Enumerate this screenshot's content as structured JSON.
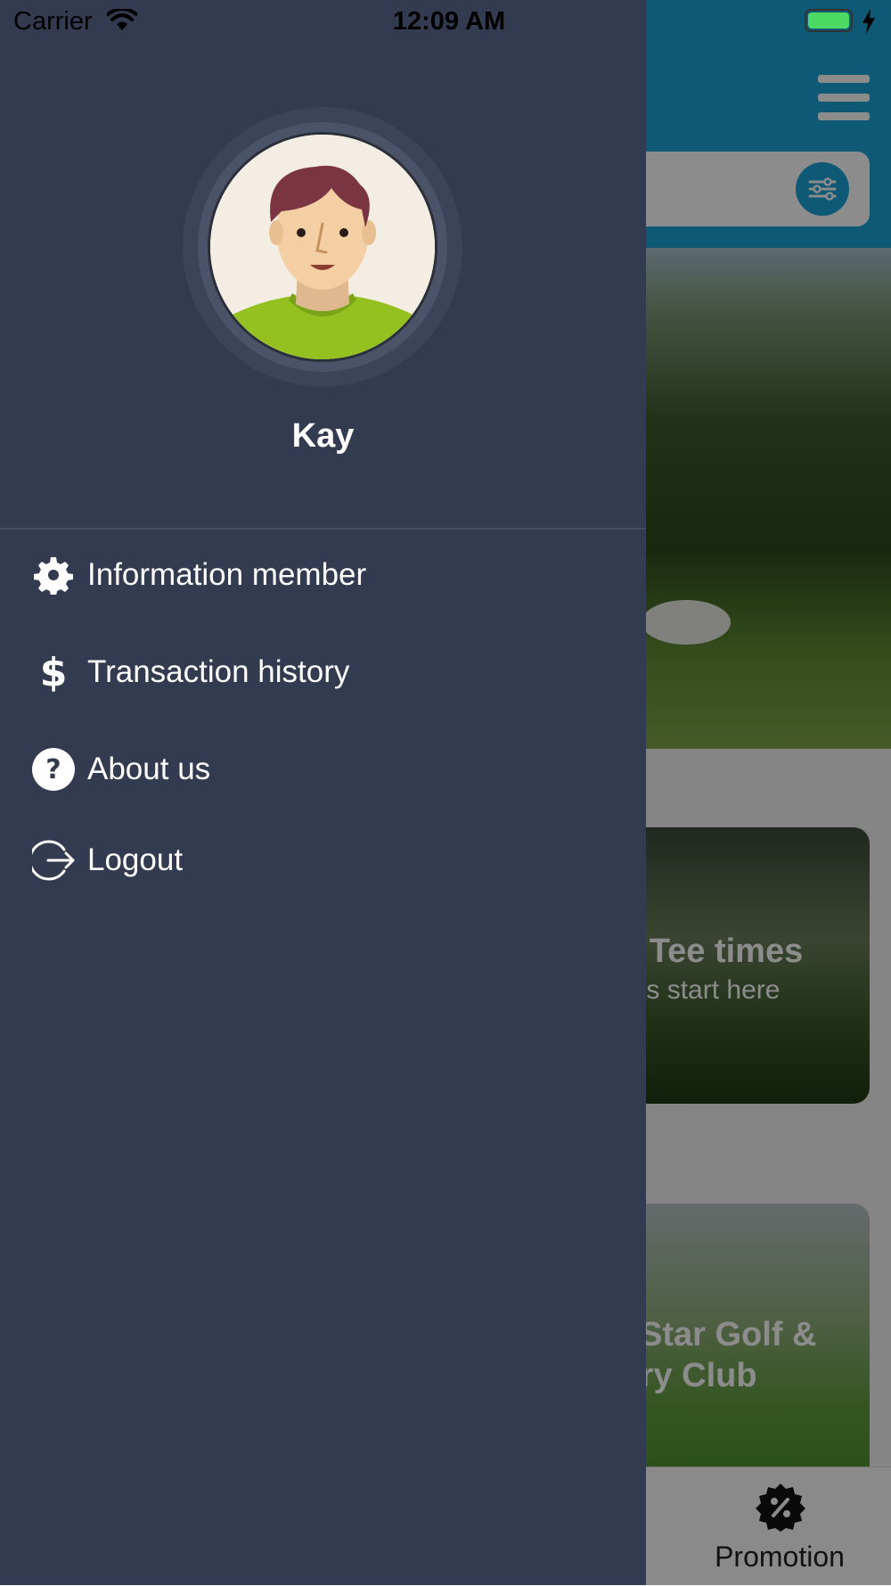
{
  "status_bar": {
    "carrier": "Carrier",
    "time": "12:09 AM",
    "battery_percent": 100
  },
  "background": {
    "card1": {
      "title": "'s Tee times",
      "subtitle": "ans start here"
    },
    "card2": {
      "title_line1": "Star Golf &",
      "title_line2": "try Club"
    },
    "tab_promotion_label": "Promotion"
  },
  "drawer": {
    "user_name": "Kay",
    "menu": [
      {
        "icon": "gear-icon",
        "label": "Information member"
      },
      {
        "icon": "dollar-icon",
        "label": "Transaction history"
      },
      {
        "icon": "question-circle-icon",
        "label": "About us"
      },
      {
        "icon": "logout-icon",
        "label": "Logout"
      }
    ]
  },
  "colors": {
    "drawer_bg": "#323b4f",
    "header_accent": "#1aa3d6",
    "battery_green": "#4cd964"
  }
}
